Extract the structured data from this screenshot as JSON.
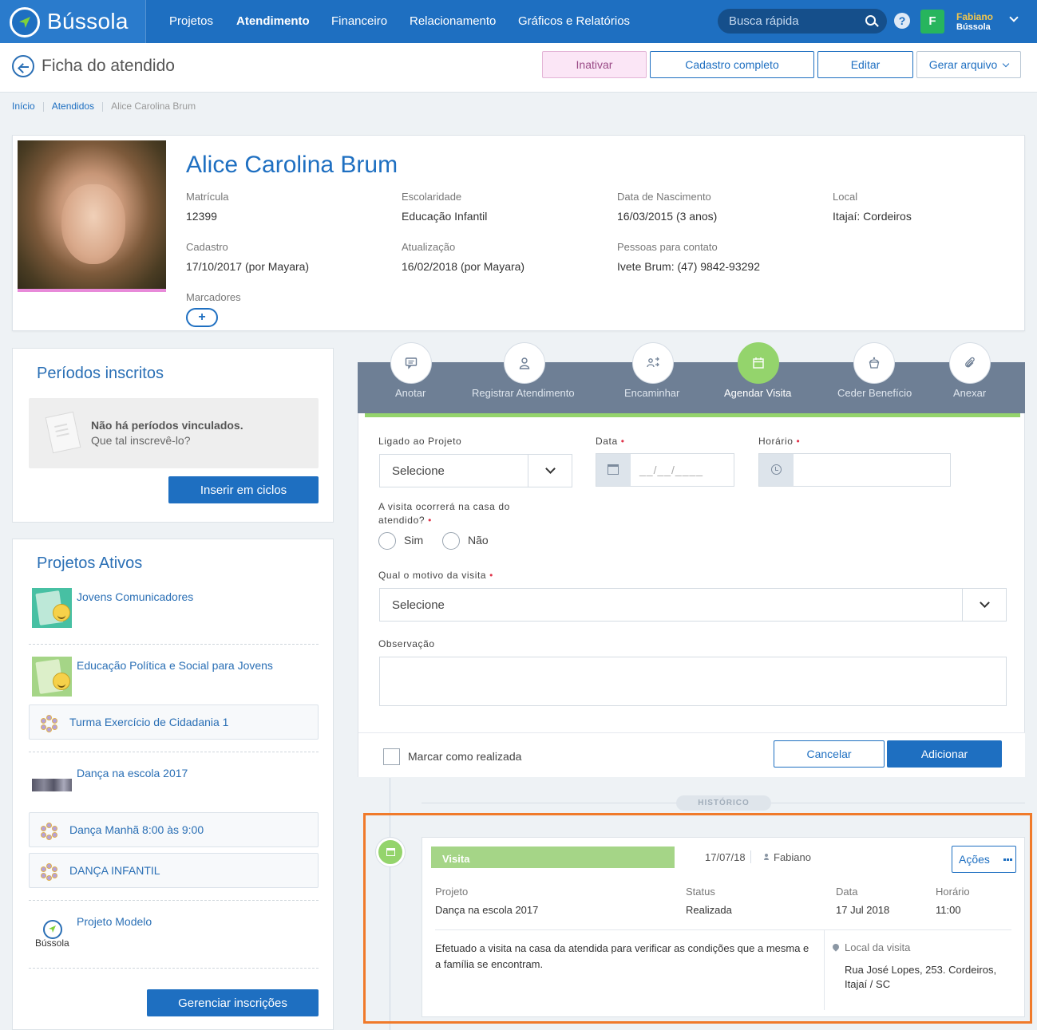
{
  "app": {
    "name": "Bússola",
    "nav": [
      "Projetos",
      "Atendimento",
      "Financeiro",
      "Relacionamento",
      "Gráficos e Relatórios"
    ],
    "active_nav": "Atendimento",
    "search_placeholder": "Busca rápida",
    "help": "?",
    "user": {
      "initial": "F",
      "name": "Fabiano",
      "org": "Bússola"
    },
    "brand_color": "#1e6fc1",
    "accent_color": "#94d46c"
  },
  "header": {
    "title": "Ficha do atendido",
    "buttons": {
      "inativar": "Inativar",
      "cadastro": "Cadastro completo",
      "editar": "Editar",
      "gerar": "Gerar arquivo"
    }
  },
  "breadcrumb": [
    "Início",
    "Atendidos",
    "Alice Carolina Brum"
  ],
  "profile": {
    "name": "Alice Carolina Brum",
    "fields": [
      {
        "label": "Matrícula",
        "value": "12399"
      },
      {
        "label": "Escolaridade",
        "value": "Educação Infantil"
      },
      {
        "label": "Data de Nascimento",
        "value": "16/03/2015 (3 anos)"
      },
      {
        "label": "Local",
        "value": "Itajaí: Cordeiros"
      },
      {
        "label": "Cadastro",
        "value": "17/10/2017 (por Mayara)"
      },
      {
        "label": "Atualização",
        "value": "16/02/2018 (por Mayara)"
      },
      {
        "label": "Pessoas para contato",
        "value": "Ivete Brum: (47) 9842-93292"
      }
    ],
    "markers_label": "Marcadores",
    "add_marker": "+"
  },
  "periodos": {
    "title": "Períodos inscritos",
    "empty_title": "Não há períodos vinculados.",
    "empty_sub": "Que tal inscrevê-lo?",
    "button": "Inserir em ciclos"
  },
  "projetos": {
    "title": "Projetos Ativos",
    "items": [
      "Jovens Comunicadores",
      "Educação Política e Social para Jovens",
      "Turma Exercício de Cidadania 1",
      "Dança na escola 2017",
      "Dança Manhã 8:00 às 9:00",
      "DANÇA INFANTIL",
      "Projeto Modelo"
    ],
    "logo_text": "Bússola",
    "button": "Gerenciar inscrições"
  },
  "actions": {
    "items": [
      "Anotar",
      "Registrar Atendimento",
      "Encaminhar",
      "Agendar Visita",
      "Ceder Benefício",
      "Anexar"
    ],
    "active": "Agendar Visita",
    "icons": [
      "comment-icon",
      "person-icon",
      "forward-icon",
      "calendar-icon",
      "gift-icon",
      "paperclip-icon"
    ]
  },
  "form": {
    "projeto_label": "Ligado ao Projeto",
    "projeto_value": "Selecione",
    "data_label": "Data",
    "data_placeholder": "__/__/____",
    "horario_label": "Horário",
    "casa_label_1": "A visita ocorrerá na casa do",
    "casa_label_2": "atendido?",
    "sim": "Sim",
    "nao": "Não",
    "motivo_label": "Qual o motivo da visita",
    "motivo_value": "Selecione",
    "obs_label": "Observação",
    "marcar": "Marcar como realizada",
    "cancelar": "Cancelar",
    "adicionar": "Adicionar",
    "required": "•"
  },
  "historico": {
    "tag": "HISTÓRICO",
    "entry": {
      "type": "Visita",
      "date": "17/07/18",
      "user": "Fabiano",
      "acoes": "Ações",
      "projeto_label": "Projeto",
      "projeto": "Dança na escola 2017",
      "status_label": "Status",
      "status": "Realizada",
      "data_label": "Data",
      "data": "17 Jul 2018",
      "horario_label": "Horário",
      "horario": "11:00",
      "note": "Efetuado a visita na casa da atendida para verificar as condições que a mesma e a família se encontram.",
      "local_label": "Local da visita",
      "local": "Rua José Lopes, 253. Cordeiros, Itajaí / SC"
    }
  }
}
